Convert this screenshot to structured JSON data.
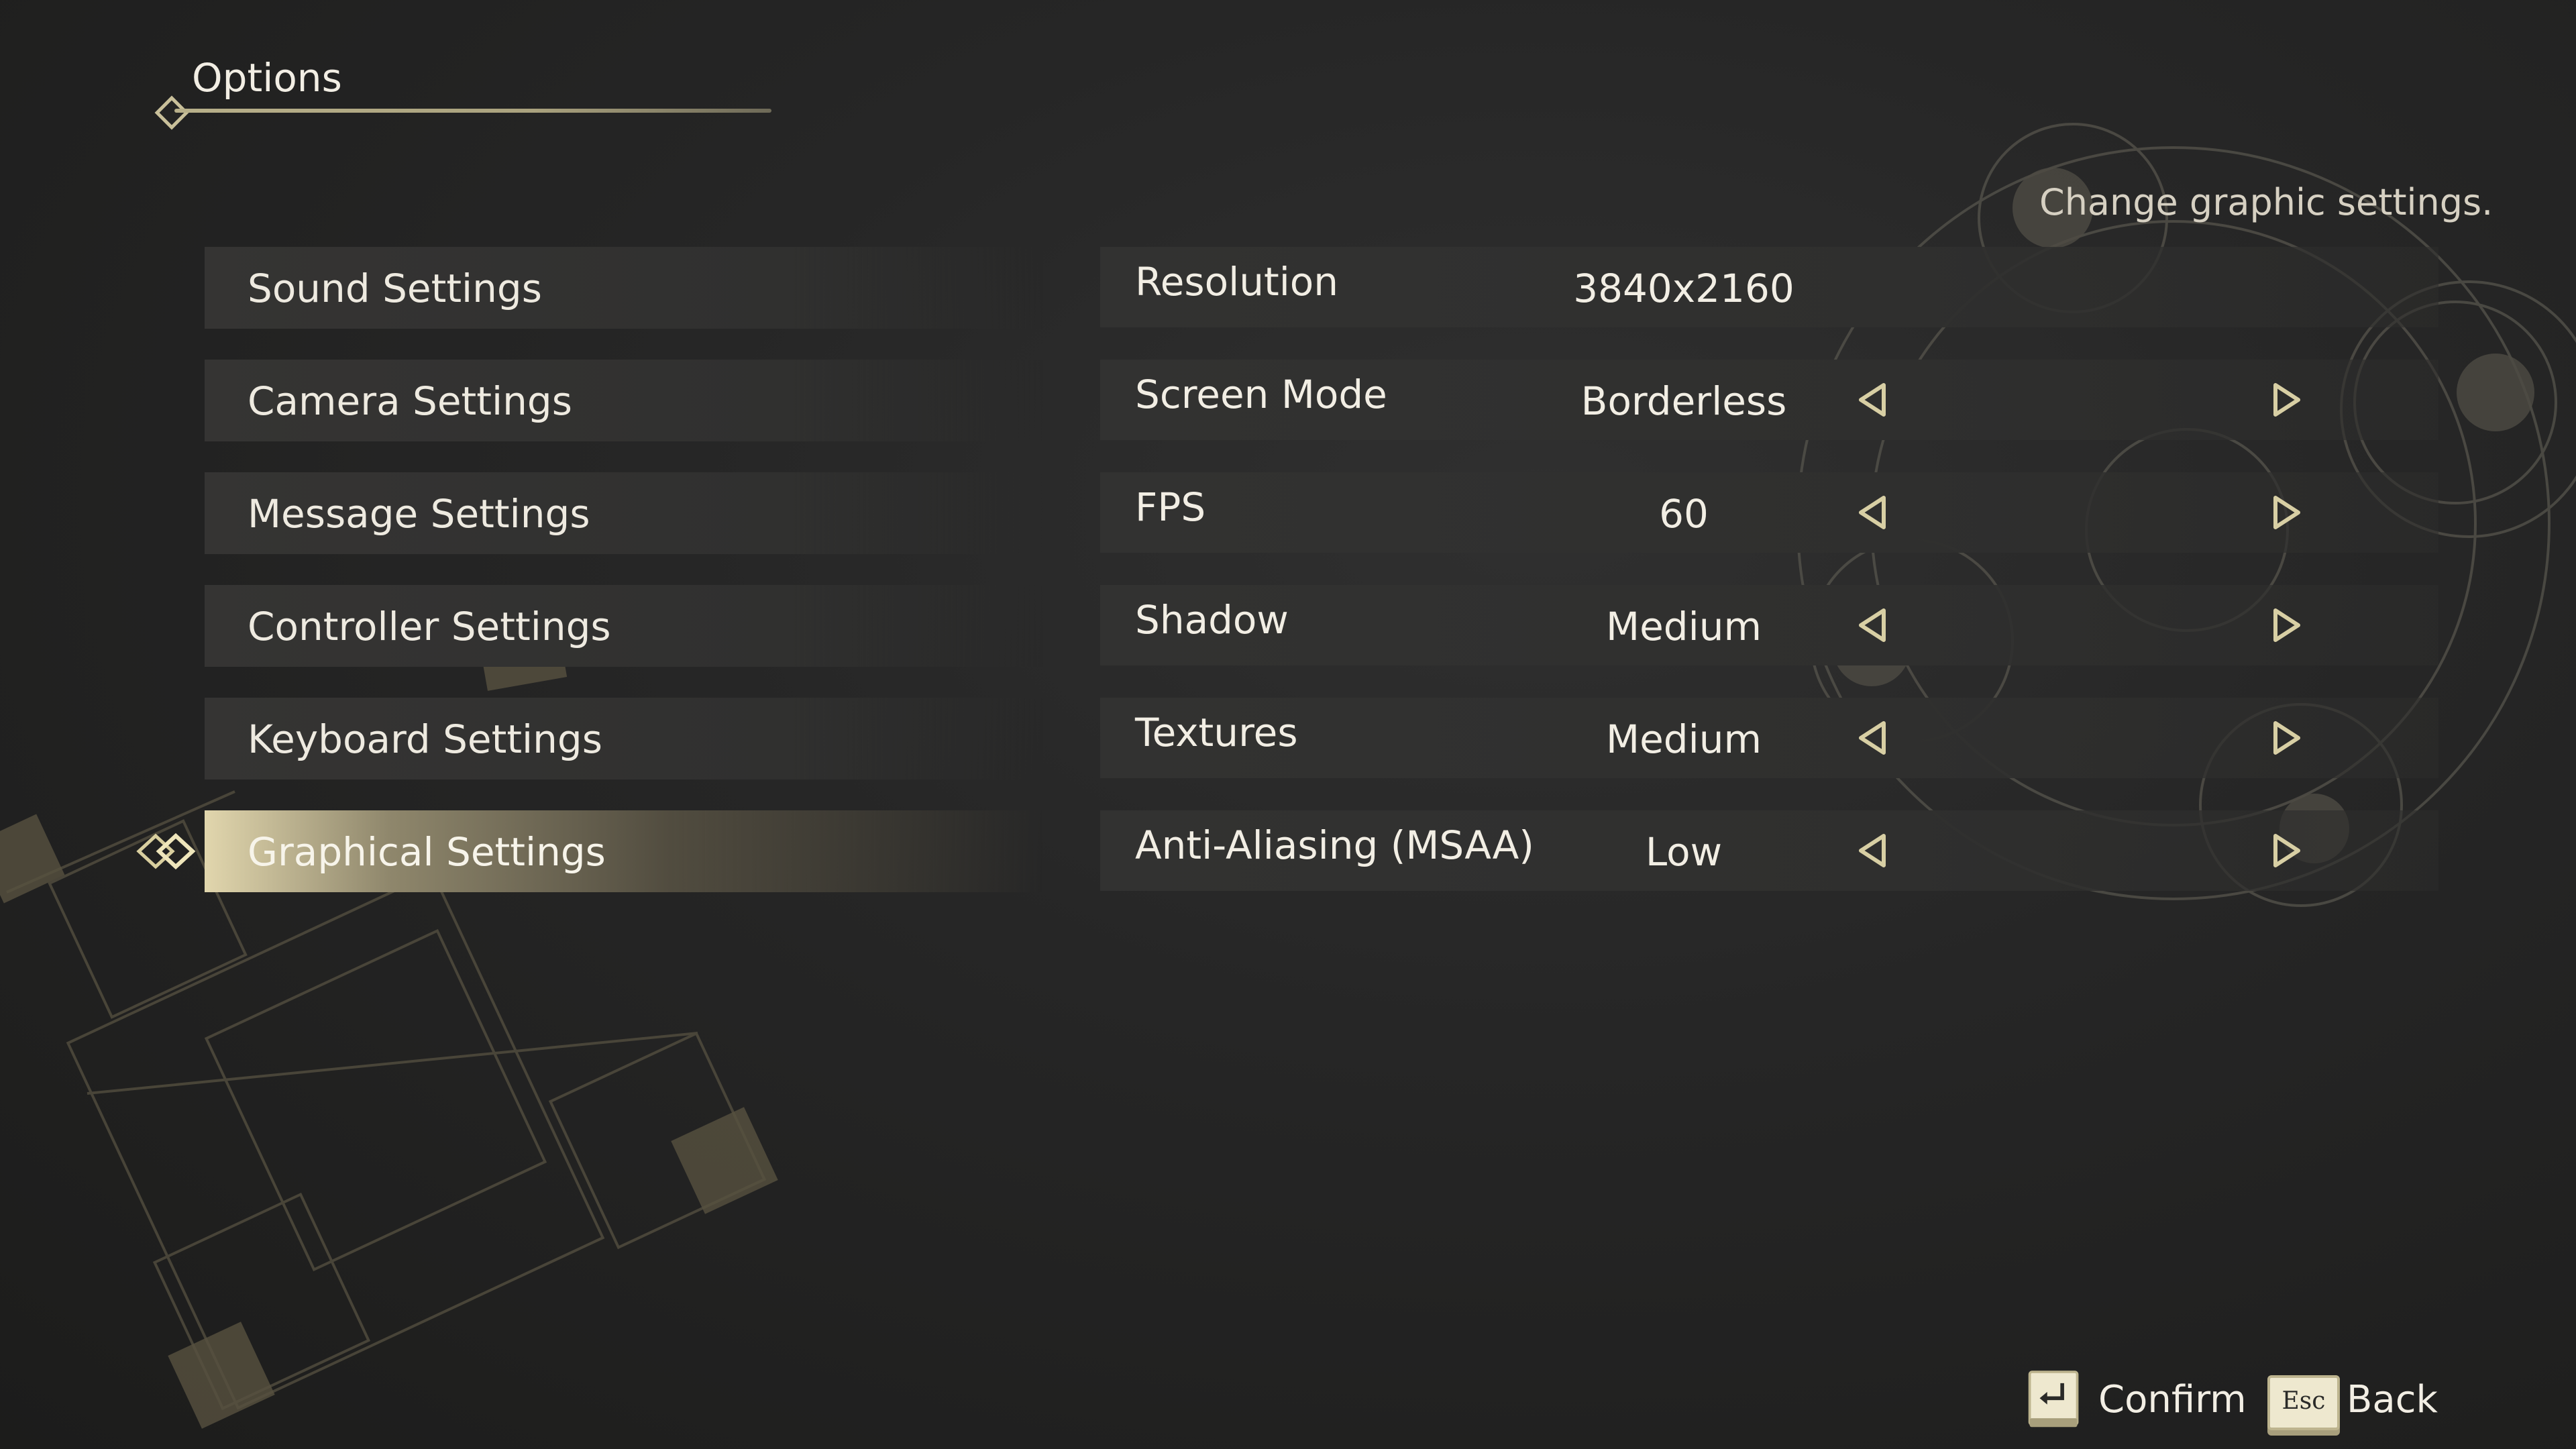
{
  "header": {
    "title": "Options"
  },
  "hint": "Change graphic settings.",
  "menu": {
    "items": [
      {
        "label": "Sound Settings"
      },
      {
        "label": "Camera Settings"
      },
      {
        "label": "Message Settings"
      },
      {
        "label": "Controller Settings"
      },
      {
        "label": "Keyboard Settings"
      },
      {
        "label": "Graphical Settings"
      }
    ],
    "selected": "Graphical Settings"
  },
  "settings": {
    "rows": [
      {
        "name": "Resolution",
        "value": "3840x2160"
      },
      {
        "name": "Screen Mode",
        "value": "Borderless"
      },
      {
        "name": "FPS",
        "value": "60"
      },
      {
        "name": "Shadow",
        "value": "Medium"
      },
      {
        "name": "Textures",
        "value": "Medium"
      },
      {
        "name": "Anti-Aliasing (MSAA)",
        "value": "Low"
      }
    ]
  },
  "footer": {
    "confirm_label": "Confirm",
    "back_label": "Back",
    "esc_key": "Esc"
  },
  "icons": {
    "left_arrow": "triangle-left-icon",
    "right_arrow": "triangle-right-icon",
    "enter_key": "enter-key-icon",
    "esc_key": "esc-key-icon",
    "selection_marker": "double-diamond-icon"
  },
  "colors": {
    "accent_gold": "#c9c09a",
    "background": "#262626",
    "text": "#f2eee4"
  }
}
